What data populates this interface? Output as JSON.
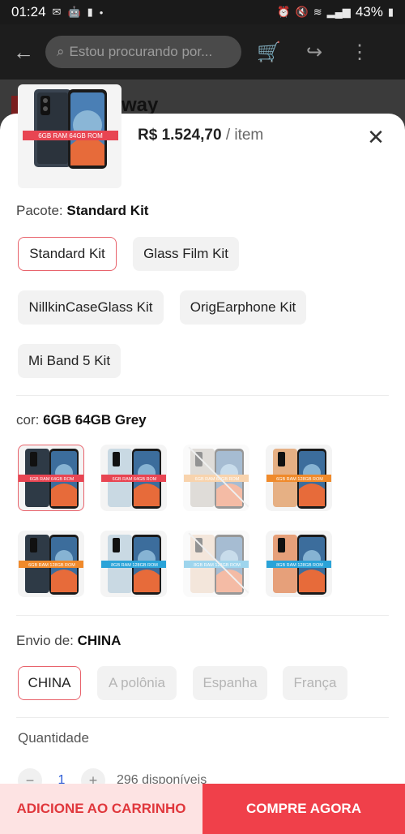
{
  "status_bar": {
    "time": "01:24",
    "battery": "43%"
  },
  "app_bar": {
    "search_placeholder": "Estou procurando por..."
  },
  "behind_text": "way",
  "sheet": {
    "thumbnail_badge": "6GB RAM 64GB ROM",
    "price": "R$ 1.524,70",
    "price_unit": "/ item",
    "package": {
      "label": "Pacote:",
      "selected": "Standard Kit",
      "options": [
        "Standard Kit",
        "Glass Film Kit",
        "NillkinCaseGlass Kit",
        "OrigEarphone Kit",
        "Mi Band 5 Kit"
      ]
    },
    "color": {
      "label": "cor:",
      "selected": "6GB 64GB Grey",
      "swatches": [
        {
          "badge": "6GB RAM 64GB ROM",
          "bg": "#2e3a46",
          "band": "#e84552"
        },
        {
          "badge": "6GB RAM 64GB ROM",
          "bg": "#c9d9e3",
          "band": "#e84552"
        },
        {
          "badge": "6GB RAM 64GB ROM",
          "bg": "#b9b3aa",
          "band": "#f0a04b"
        },
        {
          "badge": "6GB RAM 128GB ROM",
          "bg": "#e6b084",
          "band": "#f08a2b"
        },
        {
          "badge": "6GB RAM 128GB ROM",
          "bg": "#2e3a46",
          "band": "#f08a2b"
        },
        {
          "badge": "8GB RAM 128GB ROM",
          "bg": "#c9d9e3",
          "band": "#2aa3d8"
        },
        {
          "badge": "8GB RAM 128GB ROM",
          "bg": "#e6c8b0",
          "band": "#2aa3d8"
        },
        {
          "badge": "8GB RAM 128GB ROM",
          "bg": "#e6a07a",
          "band": "#2aa3d8"
        }
      ]
    },
    "ship": {
      "label": "Envio de:",
      "selected": "CHINA",
      "options": [
        "CHINA",
        "A polônia",
        "Espanha",
        "França"
      ]
    },
    "quantity": {
      "label": "Quantidade",
      "value": "1",
      "available": "296 disponíveis"
    }
  },
  "footer": {
    "add_to_cart": "ADICIONE AO CARRINHO",
    "buy_now": "COMPRE AGORA"
  },
  "colors": {
    "accent": "#f0404a",
    "selected_border": "#e8626b"
  }
}
